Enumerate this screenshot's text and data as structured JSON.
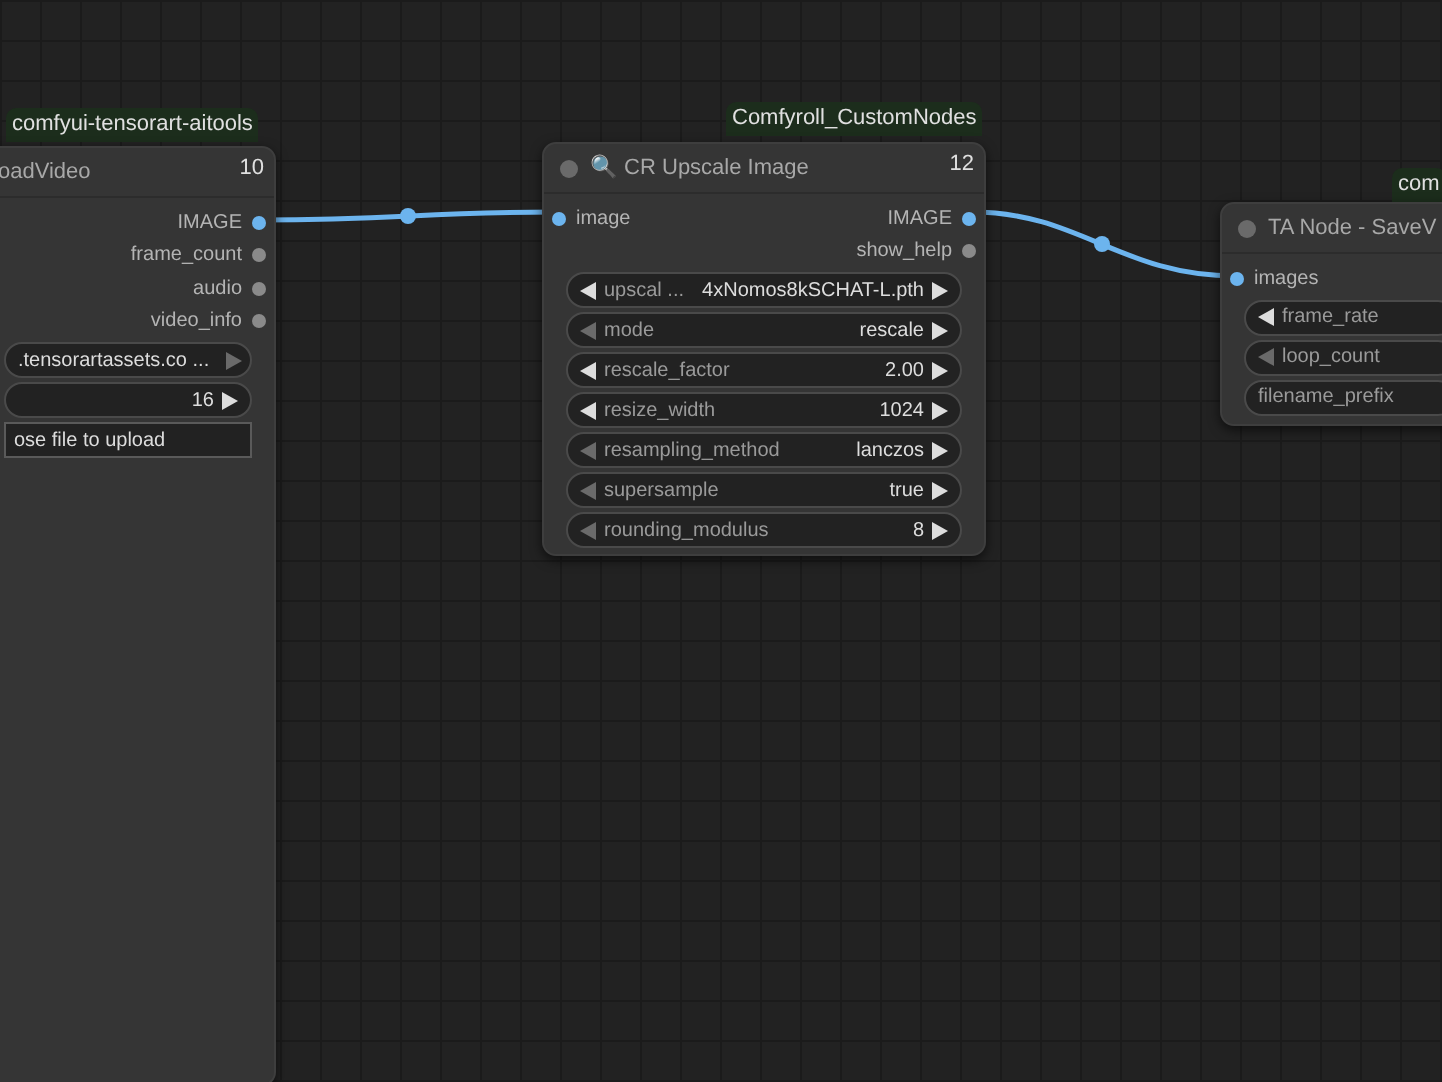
{
  "nodes": [
    {
      "badge": "comfyui-tensorart-aitools",
      "title": "oadVideo",
      "id": "10",
      "outputs": [
        {
          "label": "IMAGE",
          "connected": true
        },
        {
          "label": "frame_count",
          "connected": false
        },
        {
          "label": "audio",
          "connected": false
        },
        {
          "label": "video_info",
          "connected": false
        }
      ],
      "widgets": [
        {
          "kind": "combo",
          "label": ".tensorartassets.co ...",
          "increment_enabled": false
        },
        {
          "kind": "number",
          "value": "16",
          "increment_enabled": true
        },
        {
          "kind": "button",
          "label": "ose file to upload"
        }
      ]
    },
    {
      "badge": "Comfyroll_CustomNodes",
      "title": "🔍 CR Upscale Image",
      "id": "12",
      "title_dot": true,
      "inputs": [
        {
          "label": "image",
          "connected": true
        }
      ],
      "outputs": [
        {
          "label": "IMAGE",
          "connected": true
        },
        {
          "label": "show_help",
          "connected": false
        }
      ],
      "widgets": [
        {
          "kind": "combo",
          "label": "upscal ...",
          "value": "4xNomos8kSCHAT-L.pth",
          "decrement_enabled": true,
          "increment_enabled": true
        },
        {
          "kind": "combo",
          "label": "mode",
          "value": "rescale",
          "decrement_enabled": false,
          "increment_enabled": true
        },
        {
          "kind": "number",
          "label": "rescale_factor",
          "value": "2.00",
          "decrement_enabled": true,
          "increment_enabled": true
        },
        {
          "kind": "number",
          "label": "resize_width",
          "value": "1024",
          "decrement_enabled": true,
          "increment_enabled": true
        },
        {
          "kind": "combo",
          "label": "resampling_method",
          "value": "lanczos",
          "decrement_enabled": false,
          "increment_enabled": true
        },
        {
          "kind": "combo",
          "label": "supersample",
          "value": "true",
          "decrement_enabled": false,
          "increment_enabled": true
        },
        {
          "kind": "number",
          "label": "rounding_modulus",
          "value": "8",
          "decrement_enabled": false,
          "increment_enabled": true
        }
      ]
    },
    {
      "badge": "com",
      "title": "TA Node - SaveV",
      "title_dot": true,
      "inputs": [
        {
          "label": "images",
          "connected": true
        }
      ],
      "widgets": [
        {
          "kind": "number",
          "label": "frame_rate",
          "decrement_enabled": true
        },
        {
          "kind": "number",
          "label": "loop_count",
          "decrement_enabled": false
        },
        {
          "kind": "text",
          "label": "filename_prefix"
        }
      ]
    }
  ]
}
